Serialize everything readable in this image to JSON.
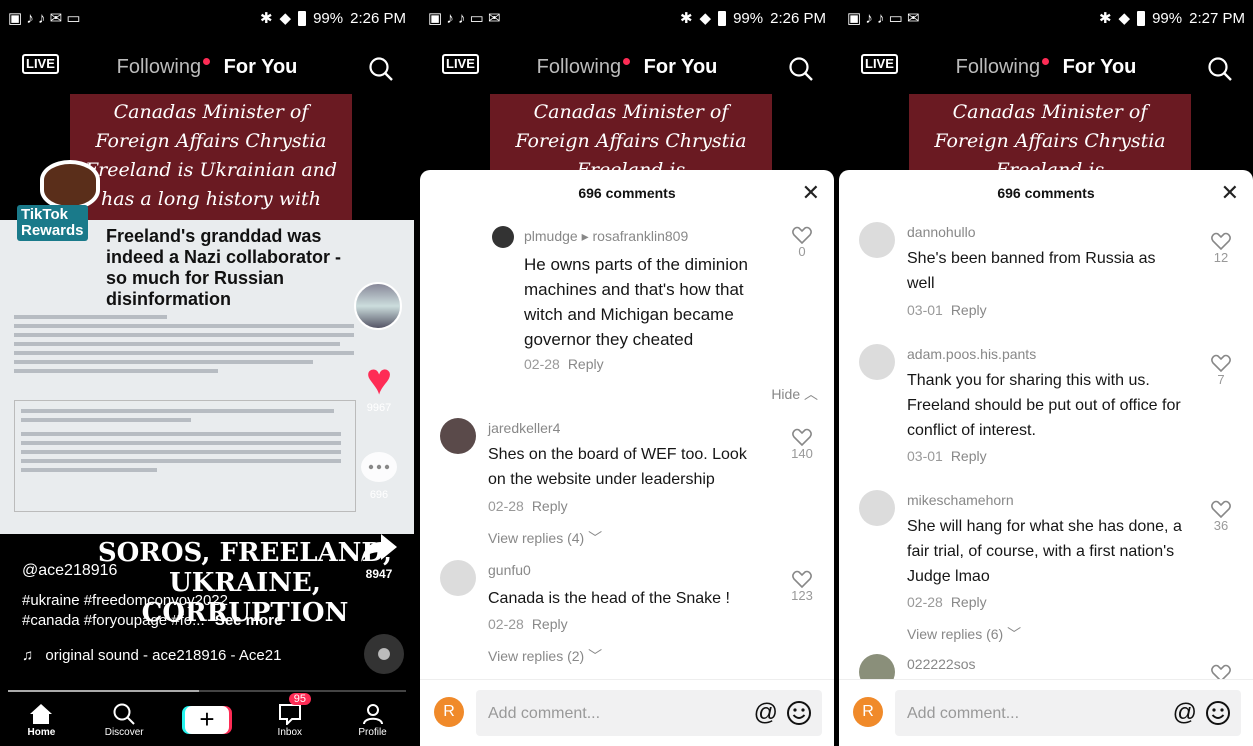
{
  "statusbar": [
    {
      "battery": "99%",
      "time": "2:26 PM"
    },
    {
      "battery": "99%",
      "time": "2:26 PM"
    },
    {
      "battery": "99%",
      "time": "2:27 PM"
    }
  ],
  "topbar": {
    "live": "LIVE",
    "following": "Following",
    "foryou": "For You"
  },
  "video": {
    "banner": "Canadas Minister of Foreign Affairs Chrystia Freeland is Ukrainian and has a long history with George Soros",
    "banner_short": "Canadas Minister of Foreign Affairs Chrystia Freeland is",
    "rewards_line1": "TikTok",
    "rewards_line2": "Rewards",
    "article_headline": "Freeland's granddad was indeed a Nazi collaborator - so much for Russian disinformation",
    "likes": "9967",
    "comments_count": "696",
    "shares": "8947",
    "username": "@ace218916",
    "caption1": "#ukraine #freedomconvoy2022",
    "caption2": "#canada #foryoupage #fo...",
    "see_more": "See more",
    "overlay_title": "SOROS, FREELAND, UKRAINE, CORRUPTION",
    "sound": "original sound - ace218916 - Ace21"
  },
  "nav": {
    "home": "Home",
    "discover": "Discover",
    "inbox": "Inbox",
    "inbox_badge": "95",
    "profile": "Profile"
  },
  "sheet": {
    "title": "696 comments",
    "reply": "Reply",
    "hide": "Hide",
    "placeholder": "Add comment..."
  },
  "comments_a": [
    {
      "user": "plmudge ▸ rosafranklin809",
      "text": "He owns parts of the diminion machines and that's how that witch and Michigan became governor they cheated",
      "date": "02-28",
      "likes": "0"
    },
    {
      "user": "jaredkeller4",
      "text": "Shes on the board of WEF too. Look on the website under leadership",
      "date": "02-28",
      "likes": "140",
      "view_replies": "View replies (4)"
    },
    {
      "user": "gunfu0",
      "text": "Canada is the head of the Snake !",
      "date": "02-28",
      "likes": "123",
      "view_replies": "View replies (2)"
    }
  ],
  "comments_b": [
    {
      "user": "dannohullo",
      "text": "She's been banned from Russia as well",
      "date": "03-01",
      "likes": "12"
    },
    {
      "user": "adam.poos.his.pants",
      "text": "Thank you for sharing this with us. Freeland should be put out of office for conflict of interest.",
      "date": "03-01",
      "likes": "7"
    },
    {
      "user": "mikeschamehorn",
      "text": "She will hang for what she has done, a fair trial, of course, with a first nation's Judge lmao",
      "date": "02-28",
      "likes": "36",
      "view_replies": "View replies (6)"
    },
    {
      "user": "022222sos"
    }
  ],
  "composer_avatar": "R",
  "colors": {
    "accent": "#fe2c55",
    "banner": "#6a1a22",
    "avatar": "#f08a2a"
  }
}
